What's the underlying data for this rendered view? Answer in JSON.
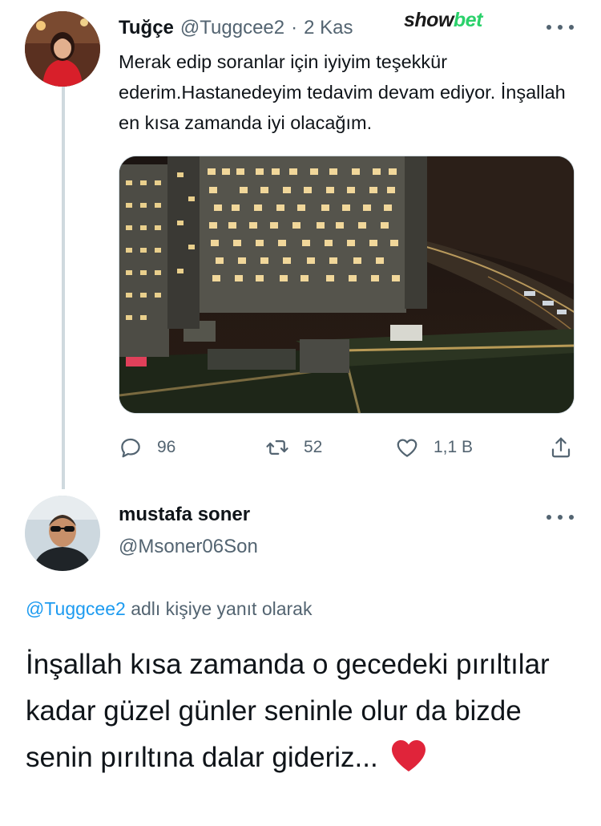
{
  "tweet1": {
    "display_name": "Tuğçe",
    "handle": "@Tuggcee2",
    "separator": "·",
    "date": "2 Kas",
    "text": "Merak edip soranlar için iyiyim teşekkür ederim.Hastanedeyim tedavim devam ediyor. İnşallah en kısa zamanda iyi olacağım.",
    "media": "night-hospital-photo",
    "stats": {
      "replies": "96",
      "retweets": "52",
      "likes": "1,1 B"
    },
    "icons": [
      "reply-icon",
      "retweet-icon",
      "like-icon",
      "share-icon",
      "more-icon"
    ]
  },
  "watermark": {
    "part1": "show",
    "part2": "bet",
    "colors": {
      "part1": "#1a1a1a",
      "part2": "#2bd16b"
    }
  },
  "tweet2": {
    "display_name": "mustafa soner",
    "handle": "@Msoner06Son",
    "reply_to_handle": "@Tuggcee2",
    "reply_to_suffix": "adlı kişiye yanıt olarak",
    "text": "İnşallah kısa zamanda o gecedeki pırıltılar kadar güzel günler seninle olur da bizde senin pırıltına dalar gideriz...",
    "emoji": "red-heart-icon"
  },
  "colors": {
    "text_primary": "#0f1419",
    "text_secondary": "#536471",
    "link": "#1d9bf0",
    "heart": "#e0243a",
    "thread_line": "#cfd9de"
  }
}
